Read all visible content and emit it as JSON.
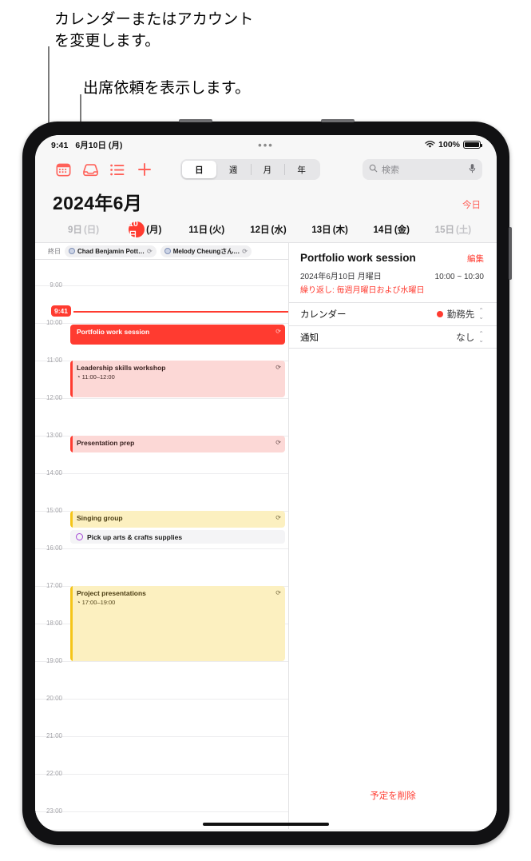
{
  "callouts": [
    {
      "id": "callout-calendar-account",
      "text": "カレンダーまたはアカウント\nを変更します。"
    },
    {
      "id": "callout-invitations",
      "text": "出席依頼を表示します。"
    }
  ],
  "status_bar": {
    "time": "9:41",
    "date": "6月10日 (月)",
    "center_dots": "•••",
    "wifi_icon": "wifi-icon",
    "battery_percent": "100%",
    "battery_icon": "battery-full-icon"
  },
  "toolbar": {
    "icons": [
      {
        "name": "calendar-icon",
        "label": "カレンダー"
      },
      {
        "name": "inbox-icon",
        "label": "出席依頼"
      },
      {
        "name": "list-icon",
        "label": "リスト"
      },
      {
        "name": "plus-icon",
        "label": "新規作成"
      }
    ],
    "segments": [
      {
        "label": "日",
        "selected": true
      },
      {
        "label": "週",
        "selected": false
      },
      {
        "label": "月",
        "selected": false
      },
      {
        "label": "年",
        "selected": false
      }
    ],
    "search": {
      "placeholder": "検索",
      "icon": "search-icon",
      "mic_icon": "microphone-icon"
    }
  },
  "header": {
    "month_title": "2024年6月",
    "today_label": "今日"
  },
  "day_strip": [
    {
      "num": "9日",
      "weekday": "(日)",
      "selected": false,
      "dim": true
    },
    {
      "num": "10日",
      "weekday": "(月)",
      "selected": true,
      "dim": false
    },
    {
      "num": "11日",
      "weekday": "(火)",
      "selected": false,
      "dim": false
    },
    {
      "num": "12日",
      "weekday": "(水)",
      "selected": false,
      "dim": false
    },
    {
      "num": "13日",
      "weekday": "(木)",
      "selected": false,
      "dim": false
    },
    {
      "num": "14日",
      "weekday": "(金)",
      "selected": false,
      "dim": false
    },
    {
      "num": "15日",
      "weekday": "(土)",
      "selected": false,
      "dim": true
    }
  ],
  "all_day": {
    "label": "終日",
    "chips": [
      {
        "text": "Chad Benjamin Pott…",
        "repeat_icon": "repeat-icon"
      },
      {
        "text": "Melody Cheungさん…",
        "repeat_icon": "repeat-icon"
      }
    ]
  },
  "timeline": {
    "hours": [
      "9:00",
      "10:00",
      "11:00",
      "12:00",
      "13:00",
      "14:00",
      "15:00",
      "16:00",
      "17:00",
      "18:00",
      "19:00",
      "20:00",
      "21:00",
      "22:00",
      "23:00"
    ],
    "now_indicator": {
      "label": "9:41"
    },
    "events": [
      {
        "title": "Portfolio work session",
        "subtitle": "",
        "style": "solid-red",
        "start": "10:00",
        "end": "10:30",
        "repeat_icon": "repeat-icon"
      },
      {
        "title": "Leadership skills workshop",
        "subtitle": "11:00–12:00",
        "style": "soft-red",
        "start": "11:00",
        "end": "12:00",
        "repeat_icon": "repeat-icon"
      },
      {
        "title": "Presentation prep",
        "subtitle": "",
        "style": "soft-red",
        "start": "13:00",
        "end": "13:30",
        "repeat_icon": "repeat-icon"
      },
      {
        "title": "Singing group",
        "subtitle": "",
        "style": "soft-yellow",
        "start": "15:00",
        "end": "15:30",
        "repeat_icon": "repeat-icon"
      },
      {
        "title": "Project presentations",
        "subtitle": "17:00–19:00",
        "style": "soft-yellow",
        "start": "17:00",
        "end": "19:00",
        "repeat_icon": "repeat-icon"
      }
    ],
    "reminders": [
      {
        "title": "Pick up arts & crafts supplies",
        "circle_icon": "reminder-circle-icon"
      }
    ]
  },
  "detail": {
    "title": "Portfolio work session",
    "edit_label": "編集",
    "date": "2024年6月10日 月曜日",
    "time": "10:00 ~ 10:30",
    "repeat": "繰り返し: 毎週月曜日および水曜日",
    "rows": [
      {
        "label": "カレンダー",
        "value": "勤務先",
        "has_dot": true,
        "dot_color": "#ff3b30",
        "chevron": "⌃⌄"
      },
      {
        "label": "通知",
        "value": "なし",
        "has_dot": false,
        "chevron": "⌃⌄"
      }
    ],
    "delete_label": "予定を削除"
  },
  "colors": {
    "accent_red": "#ff3b30",
    "tint_red": "#ff6159",
    "soft_red_bg": "#fcd8d6",
    "soft_yellow_bg": "#fcf0c0",
    "yellow_bar": "#f5c518",
    "reminder_purple": "#a447d6"
  }
}
